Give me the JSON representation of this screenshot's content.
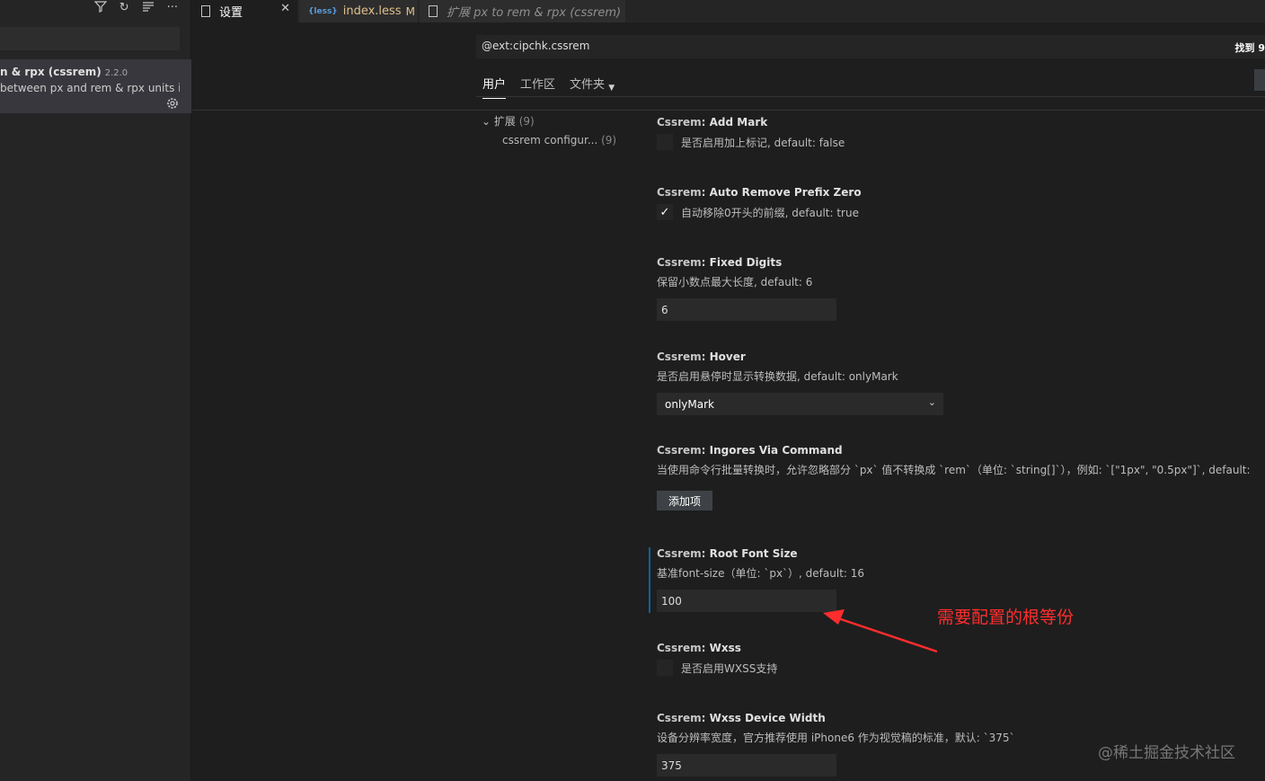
{
  "sidebar": {
    "toolbar_icons": [
      "filter-icon",
      "refresh-icon",
      "clear-icon",
      "more-icon"
    ],
    "extension": {
      "name": "n & rpx (cssrem)",
      "version": "2.2.0",
      "description": "between px and rem & rpx units i..."
    }
  },
  "tabs": {
    "settings": "设置",
    "index": "index.less",
    "index_status": "M",
    "ext": "扩展 px to rem & rpx (cssrem)"
  },
  "search": {
    "value": "@ext:cipchk.cssrem",
    "found": "找到 9"
  },
  "scope": {
    "user": "用户",
    "workspace": "工作区",
    "folder": "文件夹"
  },
  "toc": {
    "extensions": "扩展",
    "extensions_count": "(9)",
    "cssrem": "cssrem configur...",
    "cssrem_count": "(9)"
  },
  "settings": {
    "category": "Cssrem: ",
    "add_mark": {
      "title": "Add Mark",
      "desc": "是否启用加上标记, default: false",
      "checked": false
    },
    "auto_remove": {
      "title": "Auto Remove Prefix Zero",
      "desc": "自动移除0开头的前缀, default: true",
      "checked": true
    },
    "fixed_digits": {
      "title": "Fixed Digits",
      "desc": "保留小数点最大长度, default: 6",
      "value": "6"
    },
    "hover": {
      "title": "Hover",
      "desc": "是否启用悬停时显示转换数据, default: onlyMark",
      "value": "onlyMark"
    },
    "ingores": {
      "title": "Ingores Via Command",
      "desc": "当使用命令行批量转换时，允许忽略部分 `px` 值不转换成 `rem`（单位: `string[]`），例如: `[\"1px\", \"0.5px\"]`, default:",
      "button": "添加项"
    },
    "root_font": {
      "title": "Root Font Size",
      "desc": "基准font-size（单位: `px`）, default: 16",
      "value": "100"
    },
    "wxss": {
      "title": "Wxss",
      "desc": "是否启用WXSS支持",
      "checked": false
    },
    "wxss_width": {
      "title": "Wxss Device Width",
      "desc": "设备分辨率宽度，官方推荐使用 iPhone6 作为视觉稿的标准，默认: `375`",
      "value": "375"
    }
  },
  "annotation": "需要配置的根等份",
  "watermark": "@稀土掘金技术社区",
  "colors": {
    "accent": "#0e639c",
    "annotation": "#ff2d2d"
  }
}
